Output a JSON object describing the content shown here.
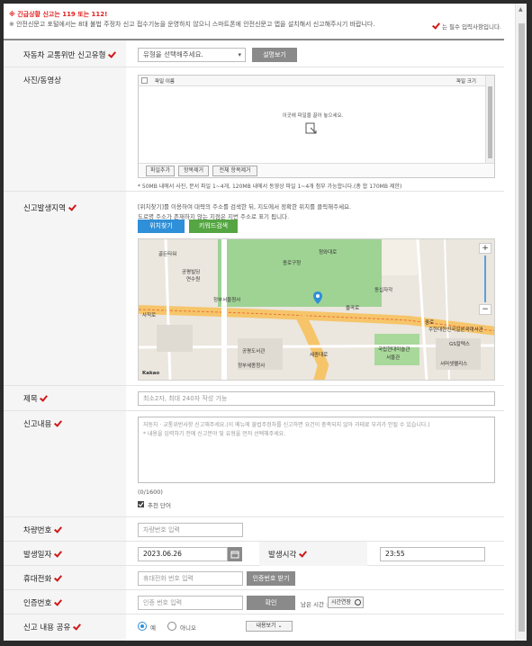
{
  "notice": {
    "line1": "※ 긴급상황 신고는 119 또는 112!",
    "line2": "※ 안전신문고 포털에서는 8대 불법 주정차 신고 접수기능을 운영하지 않으니 스마트폰에 안전신문고 앱을 설치해서 신고해주시기 바랍니다.",
    "required_note": "는 필수 입력사항입니다."
  },
  "type_row": {
    "label": "자동차 교통위반 신고유형",
    "select_value": "유형을 선택해주세요.",
    "help_button": "설명보기"
  },
  "media_row": {
    "label": "사진/동영상",
    "col_name": "파일 이름",
    "col_size": "파일 크기",
    "drop_hint": "이곳에 파일을 끌어 놓으세요.",
    "buttons": [
      "파일추가",
      "항목제거",
      "전체 항목제거"
    ],
    "limit_note": "* 50MB 내에서 사진, 문서 파일 1~4개, 120MB 내에서 동영상 파일 1~4개 첨부 가능합니다.(총 합 170MB 제한)"
  },
  "location_row": {
    "label": "신고발생지역",
    "help1": "[위치찾기]를 이용하여 대략의 주소를 검색한 뒤, 지도에서 정확한 위치를 클릭해주세요.",
    "help2": "도로명 주소가 존재하지 않는 지점은 지번 주소로 표기 됩니다.",
    "find_button": "위치찾기",
    "keyword_button": "키워드검색",
    "map_labels": [
      "골든타워",
      "공평빌딩",
      "연수원",
      "정부서울청사",
      "종로구청",
      "동십자각",
      "공평도서관",
      "정부세종청사",
      "국립현대미술관",
      "서울관",
      "청와대로",
      "율곡로",
      "사직로",
      "종로",
      "세종대로",
      "주한대한민국일본국대사관",
      "GS칼텍스",
      "서머셋팰리스",
      "Kakao"
    ],
    "zoom_in": "+",
    "zoom_out": "−"
  },
  "title_row": {
    "label": "제목",
    "placeholder": "최소2자, 최대 240자 작성 가능"
  },
  "content_row": {
    "label": "신고내용",
    "placeholder_line1": "자동차 · 교통위반사항 신고해주세요.(이 메뉴에 불법주정차를 신고하면 요건이 충족되지 않아 과태료 부과가 안될 수 있습니다.)",
    "placeholder_line2": "* 내용을 입력하기 전에 신고분야 및 유형을 먼저 선택해주세요.",
    "counter": "(0/1600)",
    "recommend_label": "추천 단어"
  },
  "plate_row": {
    "label": "차량번호",
    "placeholder": "차량번호 입력"
  },
  "date_row": {
    "label": "발생일자",
    "date_value": "2023.06.26",
    "time_label": "발생시각",
    "time_value": "23:55"
  },
  "phone_row": {
    "label": "휴대전화",
    "placeholder": "휴대전화 번호 입력",
    "button": "인증번호 받기"
  },
  "auth_row": {
    "label": "인증번호",
    "placeholder": "인증 번호 입력",
    "confirm": "확인",
    "remain_label": "남은 시간 :",
    "extend_label": "시간연장"
  },
  "share_row": {
    "label": "신고 내용 공유",
    "yes": "예",
    "no": "아니오",
    "more": "내용보기 ⌄"
  },
  "colors": {
    "accent": "#d01818",
    "blue": "#2f8fd8",
    "green": "#55a642",
    "park": "#8fcc86",
    "road": "#f6b84a"
  }
}
